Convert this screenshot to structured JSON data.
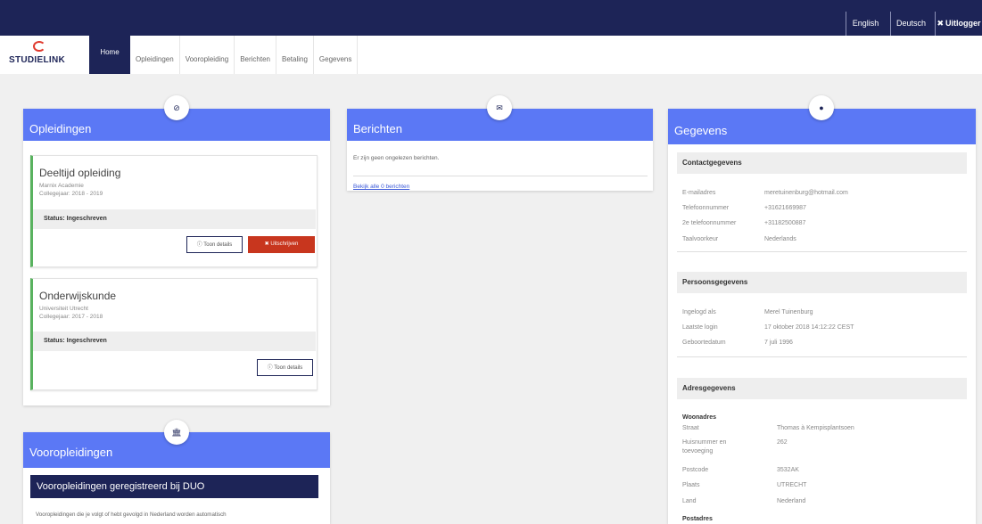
{
  "topbar": {
    "english": "English",
    "deutsch": "Deutsch",
    "logout": "Uitlogger"
  },
  "logo": {
    "text": "STUDIELINK"
  },
  "nav": {
    "home": "Home",
    "tabs": [
      "Opleidingen",
      "Vooropleiding",
      "Berichten",
      "Betaling",
      "Gegevens"
    ]
  },
  "opleidingen": {
    "title": "Opleidingen",
    "items": [
      {
        "name": "Deeltijd opleiding",
        "institution": "Marnix Academie",
        "year": "Collegejaar: 2018 - 2019",
        "status": "Status: Ingeschreven",
        "details": "Toon details",
        "unsubscribe": "Uitschrijven"
      },
      {
        "name": "Onderwijskunde",
        "institution": "Universiteit Utrecht",
        "year": "Collegejaar: 2017 - 2018",
        "status": "Status: Ingeschreven",
        "details": "Toon details"
      }
    ]
  },
  "berichten": {
    "title": "Berichten",
    "message": "Er zijn geen ongelezen berichten.",
    "link": "Bekijk alle 0 berichten"
  },
  "gegevens": {
    "title": "Gegevens",
    "contact": {
      "heading": "Contactgegevens",
      "rows": [
        {
          "label": "E-mailadres",
          "value": "meretuinenburg@hotmail.com"
        },
        {
          "label": "Telefoonnummer",
          "value": "+31621669987"
        },
        {
          "label": "2e telefoonnummer",
          "value": "+31182500887"
        },
        {
          "label": "Taalvoorkeur",
          "value": "Nederlands"
        }
      ]
    },
    "persoon": {
      "heading": "Persoonsgegevens",
      "rows": [
        {
          "label": "Ingelogd als",
          "value": "Merel Tuinenburg"
        },
        {
          "label": "Laatste login",
          "value": "17 oktober 2018 14:12:22 CEST"
        },
        {
          "label": "Geboortedatum",
          "value": "7 juli 1996"
        }
      ]
    },
    "adres": {
      "heading": "Adresgegevens",
      "woonadres": "Woonadres",
      "rows": [
        {
          "label": "Straat",
          "value": "Thomas à Kempisplantsoen"
        },
        {
          "label": "Huisnummer en toevoeging",
          "value": "262"
        },
        {
          "label": "Postcode",
          "value": "3532AK"
        },
        {
          "label": "Plaats",
          "value": "UTRECHT"
        },
        {
          "label": "Land",
          "value": "Nederland"
        }
      ],
      "postadres": "Postadres"
    }
  },
  "vooropleidingen": {
    "title": "Vooropleidingen",
    "duo_title": "Vooropleidingen geregistreerd bij DUO",
    "text": "Vooropleidingen die je volgt of hebt gevolgd in Nederland worden automatisch"
  }
}
